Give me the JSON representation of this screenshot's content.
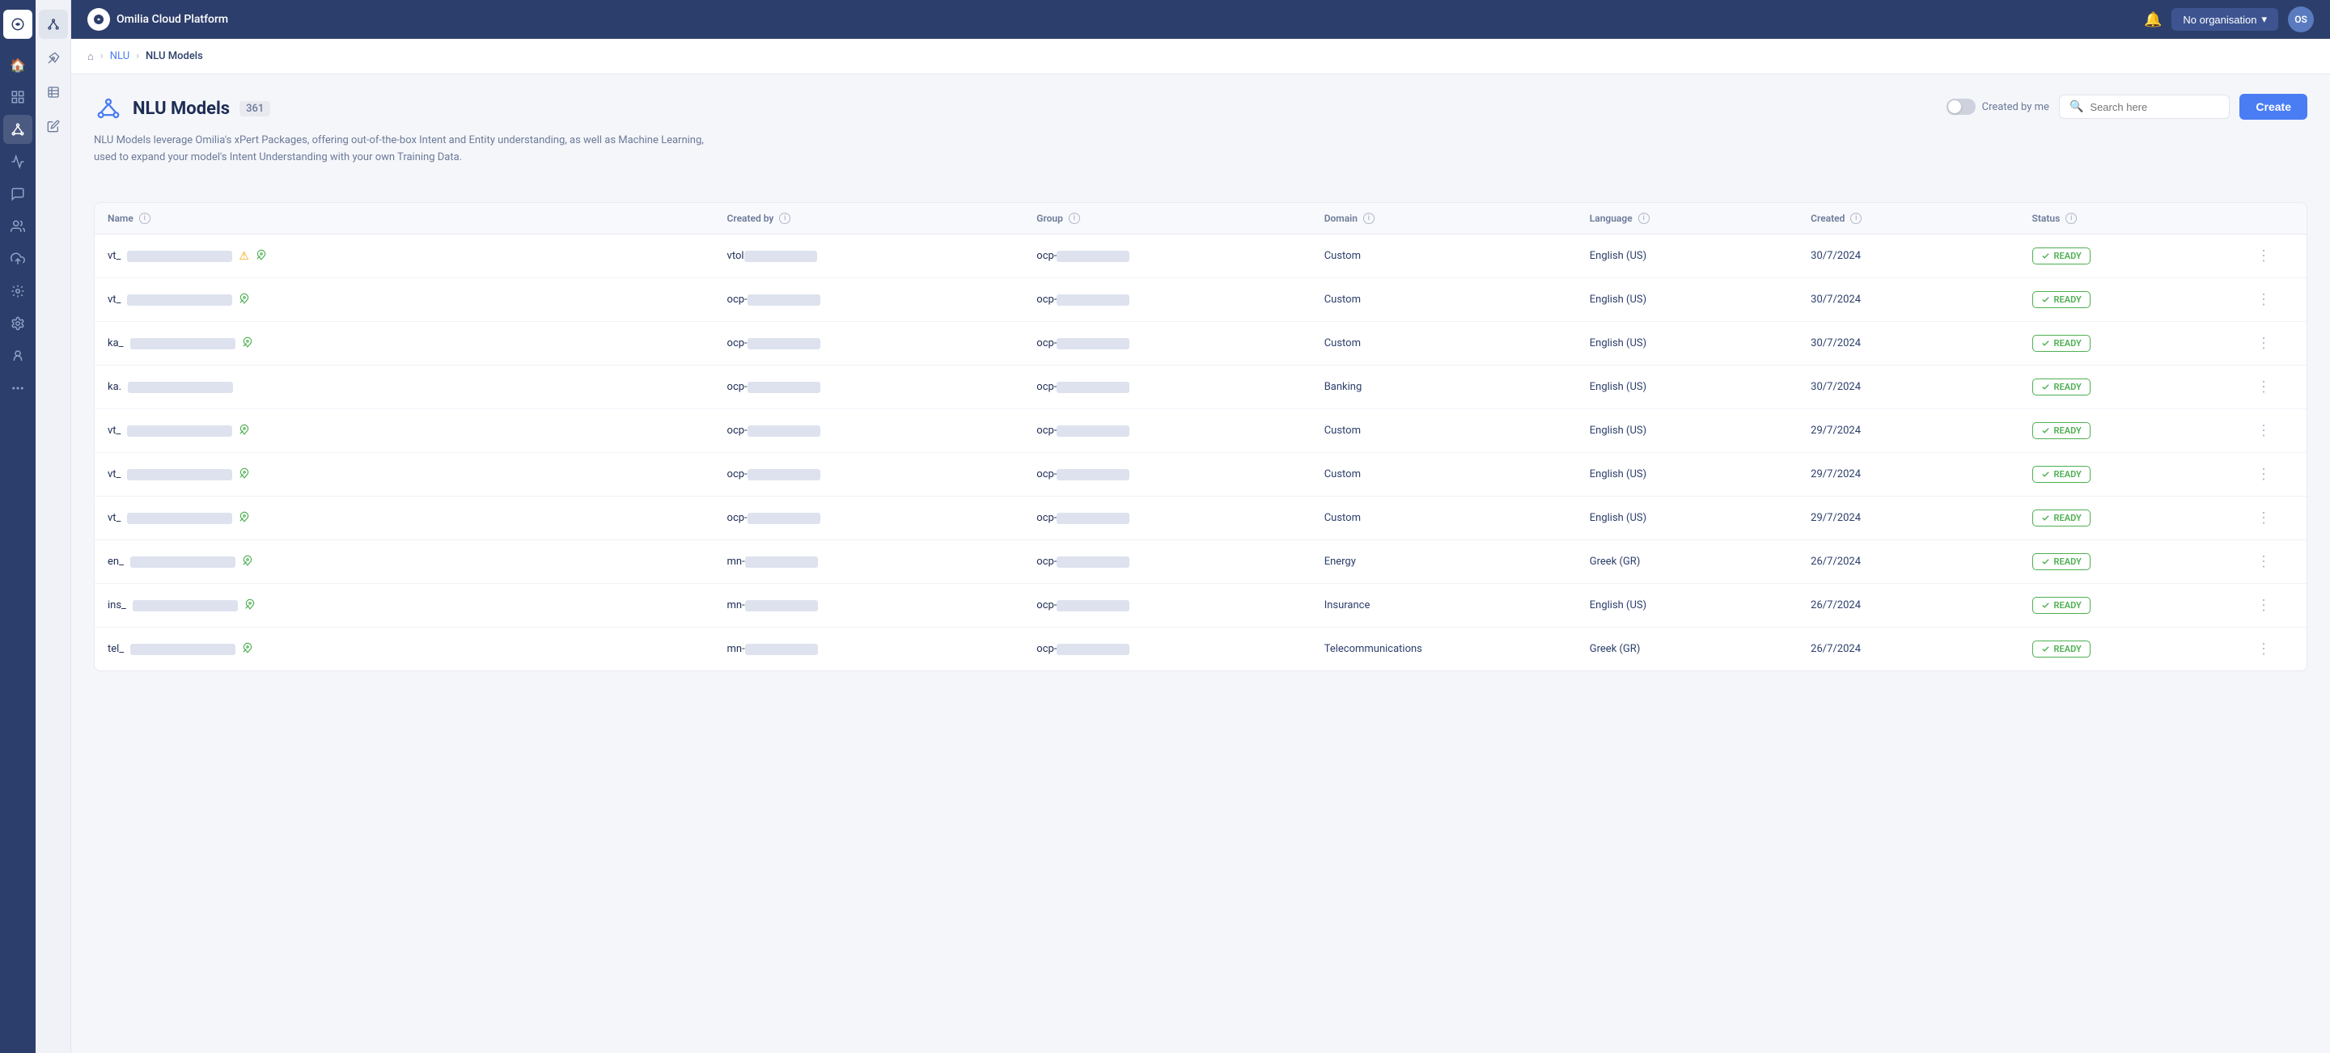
{
  "app": {
    "name": "Omilia Cloud Platform",
    "trademark": "®"
  },
  "header": {
    "bell_label": "notifications",
    "org_selector": "No organisation",
    "org_chevron": "▾",
    "avatar_initials": "OS"
  },
  "breadcrumb": {
    "home_icon": "⌂",
    "nlu_link": "NLU",
    "current": "NLU Models"
  },
  "sidebar_narrow": {
    "items": [
      {
        "icon": "⌂",
        "name": "home",
        "active": false
      },
      {
        "icon": "◫",
        "name": "layers",
        "active": false
      },
      {
        "icon": "♬",
        "name": "audio",
        "active": false
      },
      {
        "icon": "✧",
        "name": "nlu",
        "active": true
      },
      {
        "icon": "◈",
        "name": "analytics",
        "active": false
      },
      {
        "icon": "✉",
        "name": "messages",
        "active": false
      },
      {
        "icon": "⊕",
        "name": "integrations",
        "active": false
      },
      {
        "icon": "☁",
        "name": "cloud",
        "active": false
      },
      {
        "icon": "⚙",
        "name": "settings1",
        "active": false
      },
      {
        "icon": "⚙",
        "name": "settings2",
        "active": false
      },
      {
        "icon": "◑",
        "name": "theme",
        "active": false
      },
      {
        "icon": "👤",
        "name": "user",
        "active": false
      },
      {
        "icon": "⊙",
        "name": "misc",
        "active": false
      }
    ]
  },
  "sidebar_secondary": {
    "items": [
      {
        "icon": "✧",
        "name": "nlu-models",
        "active": true
      },
      {
        "icon": "🚀",
        "name": "deployments",
        "active": false
      },
      {
        "icon": "⊟",
        "name": "datasets",
        "active": false
      },
      {
        "icon": "✎",
        "name": "annotations",
        "active": false
      }
    ]
  },
  "page": {
    "icon": "✧",
    "title": "NLU Models",
    "count": "361",
    "toggle_label": "Created by me",
    "search_placeholder": "Search here",
    "create_button": "Create",
    "description": "NLU Models leverage Omilia's xPert Packages, offering out-of-the-box Intent and Entity understanding, as well as Machine Learning, used to expand your model's Intent Understanding with your own Training Data."
  },
  "table": {
    "columns": [
      {
        "label": "Name",
        "info": true
      },
      {
        "label": "Created by",
        "info": true
      },
      {
        "label": "Group",
        "info": true
      },
      {
        "label": "Domain",
        "info": true
      },
      {
        "label": "Language",
        "info": true
      },
      {
        "label": "Created",
        "info": true
      },
      {
        "label": "Status",
        "info": true
      }
    ],
    "rows": [
      {
        "name_prefix": "vt_",
        "name_blurred": true,
        "has_warning": true,
        "has_rocket": true,
        "created_by_prefix": "vtol",
        "created_by_blurred": true,
        "group_prefix": "ocp-",
        "group_blurred": true,
        "domain": "Custom",
        "language": "English (US)",
        "created": "30/7/2024",
        "status": "READY"
      },
      {
        "name_prefix": "vt_",
        "name_blurred": true,
        "has_warning": false,
        "has_rocket": true,
        "created_by_prefix": "ocp-",
        "created_by_blurred": true,
        "group_prefix": "ocp-",
        "group_blurred": true,
        "domain": "Custom",
        "language": "English (US)",
        "created": "30/7/2024",
        "status": "READY"
      },
      {
        "name_prefix": "ka_",
        "name_blurred": true,
        "has_warning": false,
        "has_rocket": true,
        "created_by_prefix": "ocp-",
        "created_by_blurred": true,
        "group_prefix": "ocp-",
        "group_blurred": true,
        "domain": "Custom",
        "language": "English (US)",
        "created": "30/7/2024",
        "status": "READY"
      },
      {
        "name_prefix": "ka.",
        "name_blurred": true,
        "has_warning": false,
        "has_rocket": false,
        "created_by_prefix": "ocp-",
        "created_by_blurred": true,
        "group_prefix": "ocp-",
        "group_blurred": true,
        "domain": "Banking",
        "language": "English (US)",
        "created": "30/7/2024",
        "status": "READY"
      },
      {
        "name_prefix": "vt_",
        "name_blurred": true,
        "has_warning": false,
        "has_rocket": true,
        "created_by_prefix": "ocp-",
        "created_by_blurred": true,
        "group_prefix": "ocp-",
        "group_blurred": true,
        "domain": "Custom",
        "language": "English (US)",
        "created": "29/7/2024",
        "status": "READY"
      },
      {
        "name_prefix": "vt_",
        "name_blurred": true,
        "has_warning": false,
        "has_rocket": true,
        "created_by_prefix": "ocp-",
        "created_by_blurred": true,
        "group_prefix": "ocp-",
        "group_blurred": true,
        "domain": "Custom",
        "language": "English (US)",
        "created": "29/7/2024",
        "status": "READY"
      },
      {
        "name_prefix": "vt_",
        "name_blurred": true,
        "has_warning": false,
        "has_rocket": true,
        "created_by_prefix": "ocp-",
        "created_by_blurred": true,
        "group_prefix": "ocp-",
        "group_blurred": true,
        "domain": "Custom",
        "language": "English (US)",
        "created": "29/7/2024",
        "status": "READY"
      },
      {
        "name_prefix": "en_",
        "name_blurred": true,
        "has_warning": false,
        "has_rocket": true,
        "created_by_prefix": "mn-",
        "created_by_blurred": true,
        "group_prefix": "ocp-",
        "group_blurred": true,
        "domain": "Energy",
        "language": "Greek (GR)",
        "created": "26/7/2024",
        "status": "READY"
      },
      {
        "name_prefix": "ins_",
        "name_blurred": true,
        "has_warning": false,
        "has_rocket": true,
        "created_by_prefix": "mn-",
        "created_by_blurred": true,
        "group_prefix": "ocp-",
        "group_blurred": true,
        "domain": "Insurance",
        "language": "English (US)",
        "created": "26/7/2024",
        "status": "READY"
      },
      {
        "name_prefix": "tel_",
        "name_blurred": true,
        "has_warning": false,
        "has_rocket": true,
        "created_by_prefix": "mn-",
        "created_by_blurred": true,
        "group_prefix": "ocp-",
        "group_blurred": true,
        "domain": "Telecommunications",
        "language": "Greek (GR)",
        "created": "26/7/2024",
        "status": "READY"
      }
    ]
  }
}
